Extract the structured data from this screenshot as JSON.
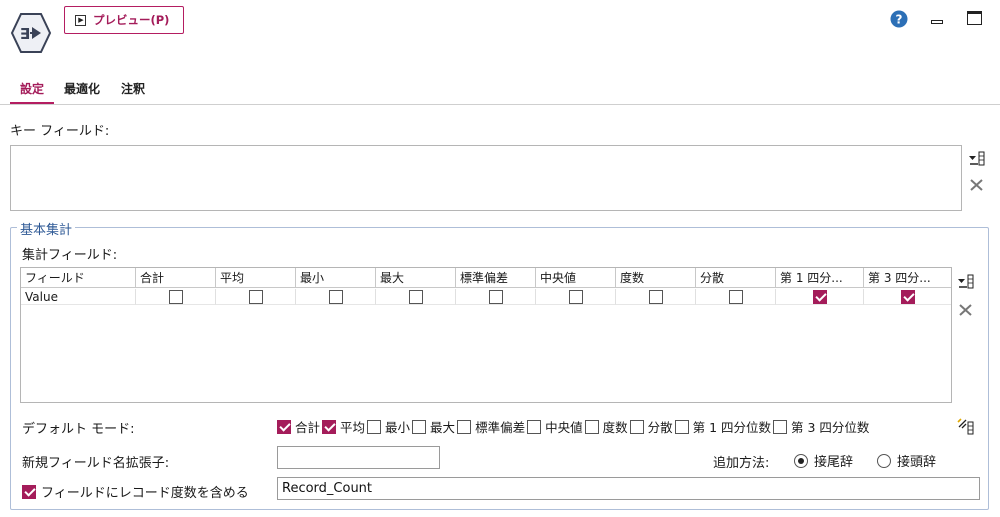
{
  "toolbar": {
    "preview_label": "プレビュー(P)"
  },
  "tabs": [
    {
      "label": "設定",
      "active": true
    },
    {
      "label": "最適化",
      "active": false
    },
    {
      "label": "注釈",
      "active": false
    }
  ],
  "key_fields": {
    "label": "キー フィールド:"
  },
  "basic_aggregation": {
    "title": "基本集計",
    "agg_fields_label": "集計フィールド:",
    "table": {
      "columns": [
        "フィールド",
        "合計",
        "平均",
        "最小",
        "最大",
        "標準偏差",
        "中央値",
        "度数",
        "分散",
        "第 1 四分...",
        "第 3 四分..."
      ],
      "rows": [
        {
          "field": "Value",
          "checks": [
            false,
            false,
            false,
            false,
            false,
            false,
            false,
            false,
            true,
            true
          ]
        }
      ]
    },
    "default_mode": {
      "label": "デフォルト モード:",
      "options": [
        {
          "label": "合計",
          "checked": true
        },
        {
          "label": "平均",
          "checked": true
        },
        {
          "label": "最小",
          "checked": false
        },
        {
          "label": "最大",
          "checked": false
        },
        {
          "label": "標準偏差",
          "checked": false
        },
        {
          "label": "中央値",
          "checked": false
        },
        {
          "label": "度数",
          "checked": false
        },
        {
          "label": "分散",
          "checked": false
        },
        {
          "label": "第 1 四分位数",
          "checked": false
        },
        {
          "label": "第 3 四分位数",
          "checked": false
        }
      ]
    },
    "new_field_ext": {
      "label": "新規フィールド名拡張子:",
      "value": ""
    },
    "add_method": {
      "label": "追加方法:",
      "suffix_label": "接尾辞",
      "prefix_label": "接頭辞",
      "selected": "suffix"
    },
    "record_count": {
      "label": "フィールドにレコード度数を含める",
      "checked": true,
      "value": "Record_Count"
    }
  },
  "colors": {
    "accent": "#a41c5a",
    "group_title": "#2f5a96",
    "help": "#2c6fb6"
  }
}
